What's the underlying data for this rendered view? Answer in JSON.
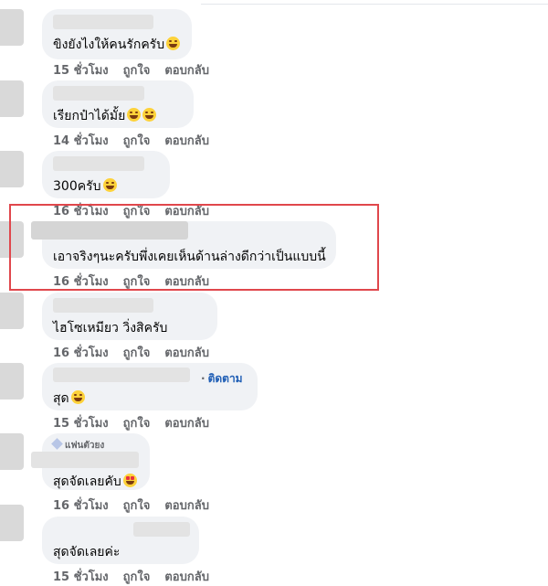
{
  "comments": [
    {
      "text": "ขิงยังไงให้คนรักครับ",
      "emoji": "laughing-squint-emoji",
      "time": "15 ชั่วโมง",
      "like": "ถูกใจ",
      "reply": "ตอบกลับ"
    },
    {
      "text": "เรียกป๋าได้มั้ย",
      "emoji": "grin-emoji",
      "emoji2": "grin-emoji",
      "time": "14 ชั่วโมง",
      "like": "ถูกใจ",
      "reply": "ตอบกลับ"
    },
    {
      "text": "300ครับ",
      "emoji": "tongue-emoji",
      "time": "16 ชั่วโมง",
      "like": "ถูกใจ",
      "reply": "ตอบกลับ"
    },
    {
      "text": "เอาจริงๆนะครับพึ่งเคยเห็นด้านล่างดีกว่าเป็นแบบนี้",
      "time": "16 ชั่วโมง",
      "like": "ถูกใจ",
      "reply": "ตอบกลับ"
    },
    {
      "text": "ไฮโซเหมียว วิ่งสิครับ",
      "time": "16 ชั่วโมง",
      "like": "ถูกใจ",
      "reply": "ตอบกลับ"
    },
    {
      "text": "สุด",
      "emoji": "smile-emoji",
      "follow": "ติดตาม",
      "time": "15 ชั่วโมง",
      "like": "ถูกใจ",
      "reply": "ตอบกลับ"
    },
    {
      "badge": "แฟนตัวยง",
      "text": "สุดจัดเลยคับ",
      "emoji": "heart-eyes-emoji",
      "time": "16 ชั่วโมง",
      "like": "ถูกใจ",
      "reply": "ตอบกลับ"
    },
    {
      "text": "สุดจัดเลยค่ะ",
      "time": "15 ชั่วโมง",
      "like": "ถูกใจ",
      "reply": "ตอบกลับ"
    }
  ],
  "colors": {
    "bubble": "#f0f2f5",
    "action_text": "#65676b",
    "highlight": "#e0474c",
    "follow_link": "#1f5eb5"
  }
}
